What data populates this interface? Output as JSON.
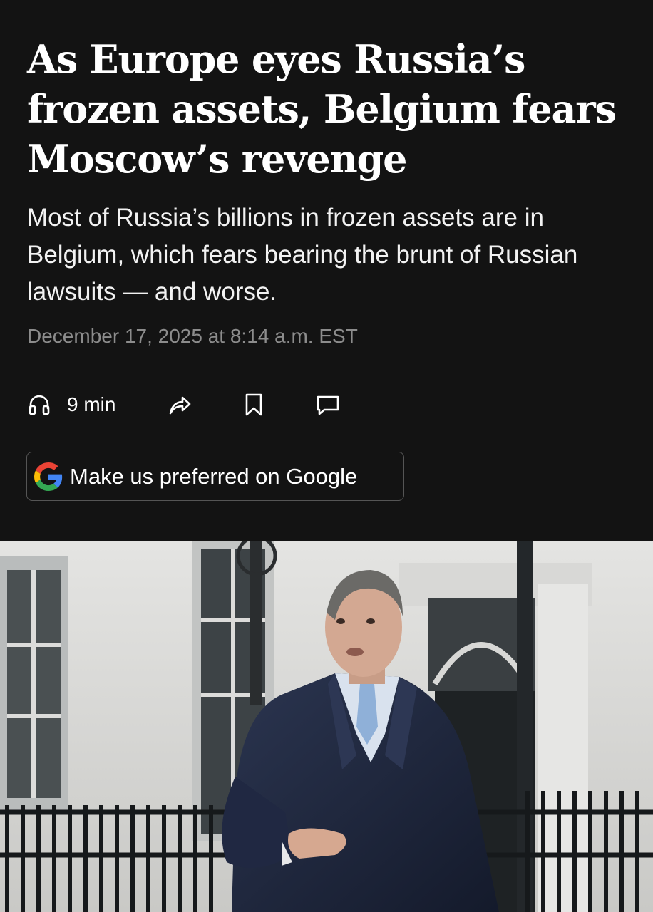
{
  "article": {
    "headline": "As Europe eyes Russia’s frozen assets, Belgium fears Moscow’s revenge",
    "dek": "Most of Russia’s billions in frozen assets are in Belgium, which fears bearing the brunt of Russian lawsuits — and worse.",
    "dateline": "December 17, 2025 at 8:14 a.m. EST"
  },
  "toolbar": {
    "listen": {
      "icon": "headphones-icon",
      "label": "9 min"
    },
    "share": {
      "icon": "share-arrow-icon"
    },
    "save": {
      "icon": "bookmark-icon"
    },
    "comments": {
      "icon": "comment-icon"
    }
  },
  "google_preferred": {
    "icon": "google-g-icon",
    "label": "Make us preferred on Google"
  },
  "colors": {
    "background": "#131313",
    "headline": "#ffffff",
    "dek": "#f2f2f2",
    "dateline": "#8c8c8c",
    "button_border": "#555555"
  }
}
